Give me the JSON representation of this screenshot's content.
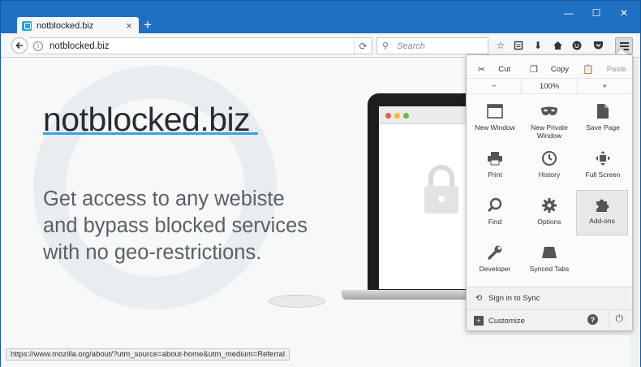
{
  "tab": {
    "title": "notblocked.biz",
    "close": "×"
  },
  "window_controls": {
    "minimize": "—",
    "maximize": "☐",
    "close": "✕"
  },
  "navbar": {
    "url": "notblocked.biz",
    "search_placeholder": "Search"
  },
  "page": {
    "title": "notblocked.biz",
    "tagline": [
      "Get access to any webiste",
      "and bypass blocked services",
      "with no geo-restrictions."
    ]
  },
  "status_text": "https://www.mozilla.org/about/?utm_source=about-home&utm_medium=Referral",
  "menu": {
    "edit": {
      "cut": "Cut",
      "copy": "Copy",
      "paste": "Paste"
    },
    "zoom": {
      "minus": "−",
      "value": "100%",
      "plus": "+"
    },
    "items": [
      {
        "label": "New Window",
        "icon": "window-icon"
      },
      {
        "label": "New Private Window",
        "icon": "mask-icon"
      },
      {
        "label": "Save Page",
        "icon": "page-icon"
      },
      {
        "label": "Print",
        "icon": "printer-icon"
      },
      {
        "label": "History",
        "icon": "clock-icon"
      },
      {
        "label": "Full Screen",
        "icon": "fullscreen-icon"
      },
      {
        "label": "Find",
        "icon": "magnifier-icon"
      },
      {
        "label": "Options",
        "icon": "gear-icon"
      },
      {
        "label": "Add-ons",
        "icon": "puzzle-icon"
      },
      {
        "label": "Developer",
        "icon": "wrench-icon"
      },
      {
        "label": "Synced Tabs",
        "icon": "synced-tabs-icon"
      }
    ],
    "sign_in": "Sign in to Sync",
    "customize": "Customize"
  },
  "colors": {
    "accent": "#1f6fc2",
    "underline": "#36a5dd"
  }
}
